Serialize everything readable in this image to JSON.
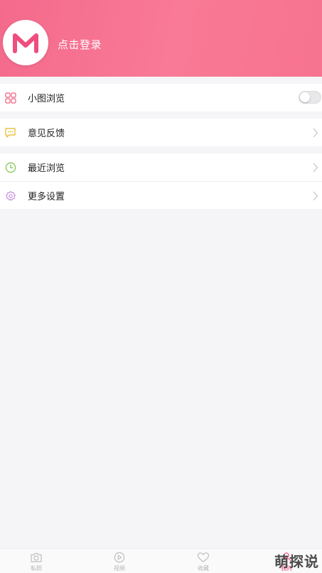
{
  "header": {
    "login_text": "点击登录",
    "gradient_colors": [
      "#f46a8c",
      "#f97a96"
    ],
    "avatar_icon": "m-logo-icon",
    "avatar_color": "#ee4d7d"
  },
  "settings": {
    "group1": [
      {
        "label": "小图浏览",
        "icon": "grid-icon",
        "icon_color": "#f0607e",
        "control": "toggle",
        "toggle_on": false
      }
    ],
    "group2": [
      {
        "label": "意见反馈",
        "icon": "chat-bubble-icon",
        "icon_color": "#e8b923",
        "control": "chevron"
      }
    ],
    "group3": [
      {
        "label": "最近浏览",
        "icon": "clock-icon",
        "icon_color": "#7cc24a",
        "control": "chevron"
      },
      {
        "label": "更多设置",
        "icon": "gear-flower-icon",
        "icon_color": "#c98be0",
        "control": "chevron"
      }
    ]
  },
  "tabbar": {
    "active_color": "#ee4d7d",
    "tabs": [
      {
        "label": "私照",
        "icon": "camera-icon",
        "active": false
      },
      {
        "label": "视频",
        "icon": "play-icon",
        "active": false
      },
      {
        "label": "收藏",
        "icon": "heart-icon",
        "active": false
      },
      {
        "label": "我的",
        "icon": "user-icon",
        "active": true
      }
    ]
  },
  "watermark": "萌探说"
}
